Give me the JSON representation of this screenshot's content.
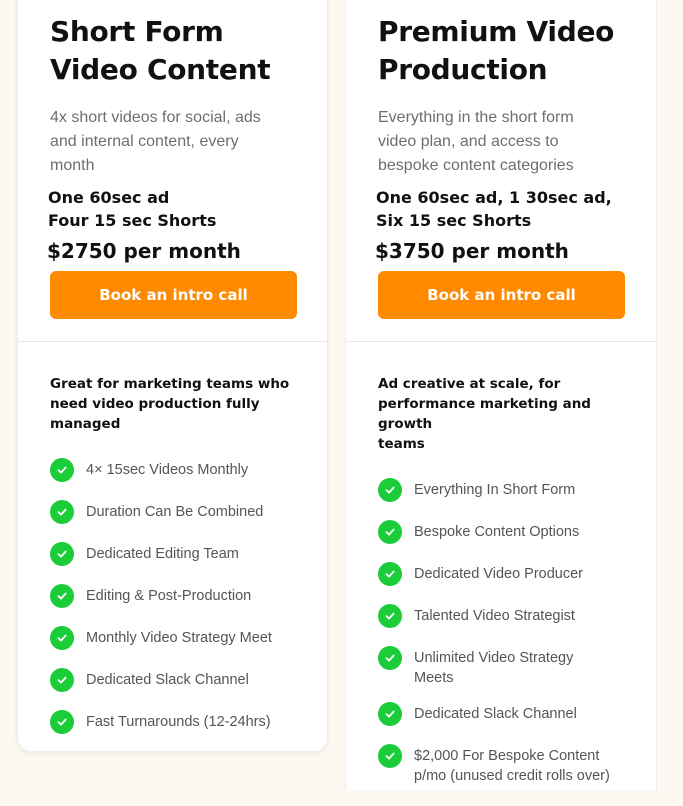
{
  "plans": [
    {
      "title": "Short Form\nVideo Content",
      "description": "4x short videos for social, ads\nand internal content, every\nmonth",
      "deliverables": "One 60sec ad\nFour 15 sec Shorts",
      "price": "$2750 per month",
      "cta_label": "Book an intro call",
      "audience": "Great for marketing teams who\nneed video production fully\nmanaged",
      "features": [
        "4× 15sec Videos Monthly",
        "Duration Can Be Combined",
        "Dedicated Editing Team",
        "Editing & Post-Production",
        "Monthly Video Strategy Meet",
        "Dedicated Slack Channel",
        "Fast Turnarounds (12-24hrs)"
      ]
    },
    {
      "title": "Premium Video\nProduction",
      "description": "Everything in the short form\nvideo plan, and access to\nbespoke content categories",
      "deliverables": "One 60sec ad, 1 30sec ad,\nSix 15 sec Shorts",
      "price": "$3750 per month",
      "cta_label": "Book an intro call",
      "audience": "Ad creative at scale, for\nperformance marketing and growth\nteams",
      "features": [
        "Everything In Short Form",
        "Bespoke Content Options",
        "Dedicated Video Producer",
        "Talented Video Strategist",
        "Unlimited Video Strategy\nMeets",
        "Dedicated Slack Channel",
        "$2,000 For Bespoke Content\np/mo (unused credit rolls over)"
      ]
    }
  ],
  "colors": {
    "accent": "#ff8a00",
    "check": "#1ccd3a",
    "background": "#fdf8f1"
  },
  "icons": {
    "feature": "check-circle-icon"
  }
}
